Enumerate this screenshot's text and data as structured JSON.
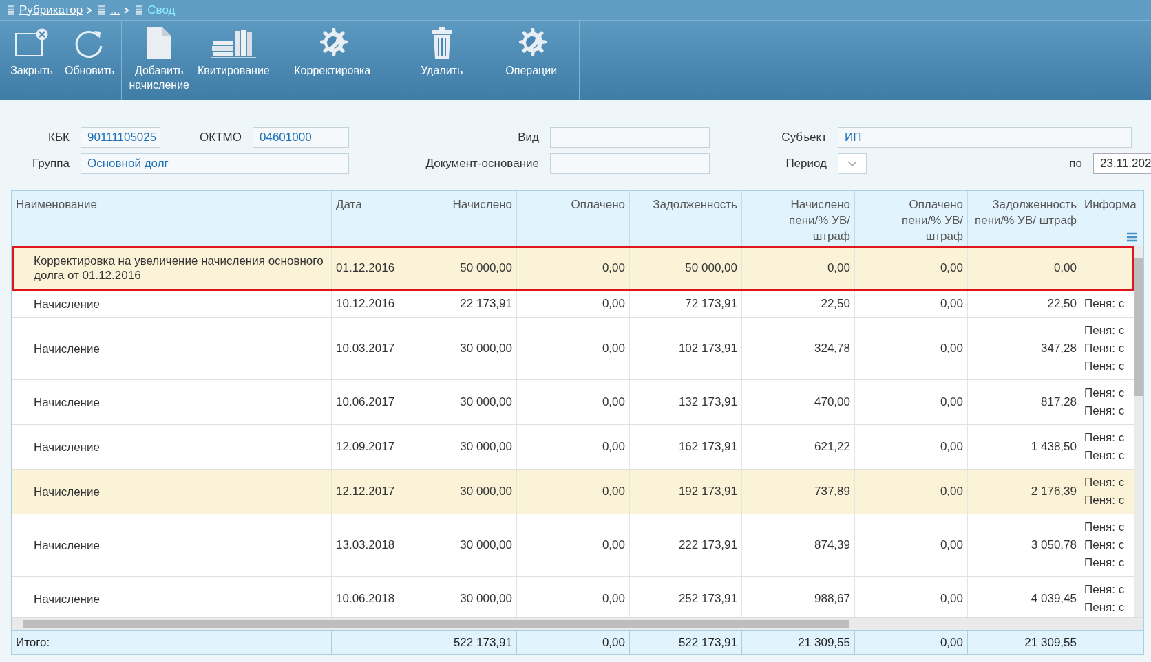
{
  "breadcrumbs": [
    {
      "label": "Рубрикатор",
      "current": false
    },
    {
      "label": "...",
      "current": false
    },
    {
      "label": "Свод",
      "current": true
    }
  ],
  "toolbar": {
    "groups": [
      [
        {
          "label": "Закрыть"
        },
        {
          "label": "Обновить"
        }
      ],
      [
        {
          "label": "Добавить начисление"
        },
        {
          "label": "Квитирование"
        },
        {
          "label": "Корректировка"
        }
      ],
      [
        {
          "label": "Удалить"
        },
        {
          "label": "Операции"
        }
      ]
    ]
  },
  "filters": {
    "kbk": {
      "label": "КБК",
      "value": "90111105025"
    },
    "oktmo": {
      "label": "ОКТМО",
      "value": "04601000"
    },
    "vid": {
      "label": "Вид"
    },
    "subject": {
      "label": "Субъект",
      "value": "ИП"
    },
    "group": {
      "label": "Группа",
      "value": "Основной долг"
    },
    "doc": {
      "label": "Документ-основание"
    },
    "period": {
      "label": "Период"
    },
    "to": {
      "label": "по",
      "value": "23.11.202"
    }
  },
  "table": {
    "columns": [
      "Наименование",
      "Дата",
      "Начислено",
      "Оплачено",
      "Задолженность",
      "Начислено пени/% УВ/ штраф",
      "Оплачено пени/% УВ/ штраф",
      "Задолженность пени/% УВ/ штраф",
      "Информа"
    ],
    "rows": [
      {
        "name": "Корректировка на увеличение начисления основного долга от 01.12.2016",
        "date": "01.12.2016",
        "values": [
          "50 000,00",
          "0,00",
          "50 000,00",
          "0,00",
          "0,00",
          "0,00"
        ],
        "info": [],
        "selected": true,
        "highlighted": true
      },
      {
        "name": "Начисление",
        "date": "10.12.2016",
        "values": [
          "22 173,91",
          "0,00",
          "72 173,91",
          "22,50",
          "0,00",
          "22,50"
        ],
        "info": [
          "Пеня: с"
        ],
        "selected": false,
        "highlighted": false
      },
      {
        "name": "Начисление",
        "date": "10.03.2017",
        "values": [
          "30 000,00",
          "0,00",
          "102 173,91",
          "324,78",
          "0,00",
          "347,28"
        ],
        "info": [
          "Пеня: с",
          "Пеня: с",
          "Пеня: с"
        ],
        "selected": false,
        "highlighted": false
      },
      {
        "name": "Начисление",
        "date": "10.06.2017",
        "values": [
          "30 000,00",
          "0,00",
          "132 173,91",
          "470,00",
          "0,00",
          "817,28"
        ],
        "info": [
          "Пеня: с",
          "Пеня: с"
        ],
        "selected": false,
        "highlighted": false
      },
      {
        "name": "Начисление",
        "date": "12.09.2017",
        "values": [
          "30 000,00",
          "0,00",
          "162 173,91",
          "621,22",
          "0,00",
          "1 438,50"
        ],
        "info": [
          "Пеня: с",
          "Пеня: с"
        ],
        "selected": false,
        "highlighted": false
      },
      {
        "name": "Начисление",
        "date": "12.12.2017",
        "values": [
          "30 000,00",
          "0,00",
          "192 173,91",
          "737,89",
          "0,00",
          "2 176,39"
        ],
        "info": [
          "Пеня: с",
          "Пеня: с"
        ],
        "selected": false,
        "highlighted": true
      },
      {
        "name": "Начисление",
        "date": "13.03.2018",
        "values": [
          "30 000,00",
          "0,00",
          "222 173,91",
          "874,39",
          "0,00",
          "3 050,78"
        ],
        "info": [
          "Пеня: с",
          "Пеня: с",
          "Пеня: с"
        ],
        "selected": false,
        "highlighted": false
      },
      {
        "name": "Начисление",
        "date": "10.06.2018",
        "values": [
          "30 000,00",
          "0,00",
          "252 173,91",
          "988,67",
          "0,00",
          "4 039,45"
        ],
        "info": [
          "Пеня: с",
          "Пеня: с"
        ],
        "selected": false,
        "highlighted": false
      }
    ],
    "totals": {
      "label": "Итого:",
      "values": [
        "522 173,91",
        "0,00",
        "522 173,91",
        "21 309,55",
        "0,00",
        "21 309,55"
      ]
    }
  }
}
